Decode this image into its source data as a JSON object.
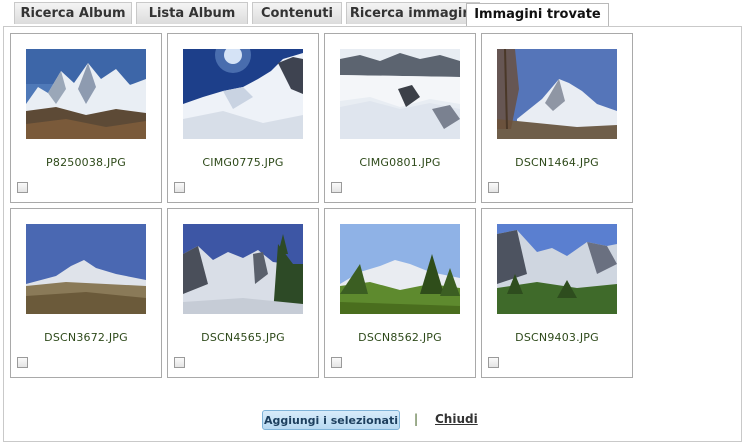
{
  "tabs": [
    {
      "label": "Ricerca Album",
      "active": false
    },
    {
      "label": "Lista Album",
      "active": false
    },
    {
      "label": "Contenuti",
      "active": false
    },
    {
      "label": "Ricerca immagini",
      "active": false
    },
    {
      "label": "Immagini trovate",
      "active": true
    }
  ],
  "images": [
    {
      "filename": "P8250038.JPG",
      "checked": false
    },
    {
      "filename": "CIMG0775.JPG",
      "checked": false
    },
    {
      "filename": "CIMG0801.JPG",
      "checked": false
    },
    {
      "filename": "DSCN1464.JPG",
      "checked": false
    },
    {
      "filename": "DSCN3672.JPG",
      "checked": false
    },
    {
      "filename": "DSCN4565.JPG",
      "checked": false
    },
    {
      "filename": "DSCN8562.JPG",
      "checked": false
    },
    {
      "filename": "DSCN9403.JPG",
      "checked": false
    }
  ],
  "actions": {
    "add_selected_label": "Aggiungi i selezionati",
    "separator": "|",
    "close_label": "Chiudi"
  },
  "colors": {
    "accent_button": "#b7d9f2",
    "filename_text": "#2e4a1a",
    "border": "#a9a9a9"
  }
}
